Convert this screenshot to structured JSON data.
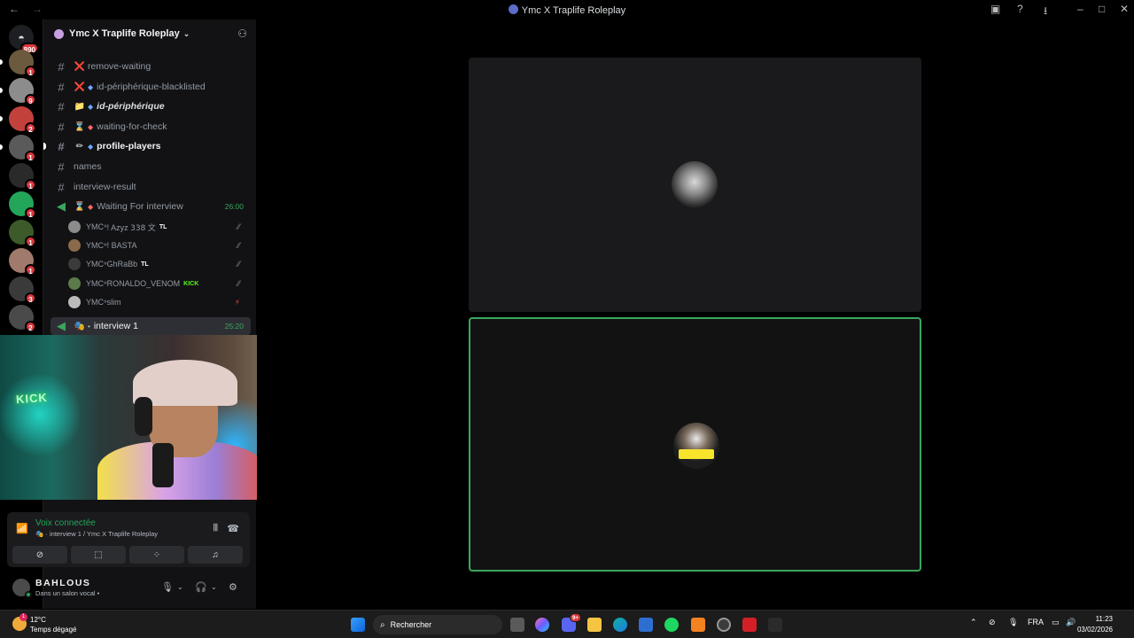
{
  "window": {
    "title": "Ymc X Traplife Roleplay"
  },
  "rail": {
    "home_badge": "890",
    "servers": [
      {
        "badge": "1",
        "color": "#6b5a3d"
      },
      {
        "badge": "9",
        "color": "#8c8c8c"
      },
      {
        "badge": "2",
        "color": "#c2413b"
      },
      {
        "badge": "1",
        "color": "#5a5a5a"
      },
      {
        "badge": "1",
        "color": "#2a2a2a"
      },
      {
        "badge": "1",
        "color": "#23a55a"
      },
      {
        "badge": "1",
        "color": "#3d5a2a"
      },
      {
        "badge": "1",
        "color": "#a07a6b"
      },
      {
        "badge": "3",
        "color": "#3a3a3a"
      },
      {
        "badge": "2",
        "color": "#4a4a4a"
      }
    ]
  },
  "server": {
    "name": "Ymc X Traplife Roleplay",
    "chevron": "⌄"
  },
  "channels": [
    {
      "emoji": "❌",
      "name": "remove-waiting",
      "diamond": ""
    },
    {
      "emoji": "❌",
      "name": "id-périphérique-blacklisted",
      "diamond": "◆"
    },
    {
      "emoji": "📁",
      "name": "id-périphérique",
      "diamond": "◆"
    },
    {
      "emoji": "⌛",
      "name": "waiting-for-check",
      "diamond": "◆"
    },
    {
      "emoji": "✏",
      "name": "profile-players",
      "diamond": "◆"
    },
    {
      "emoji": "",
      "name": "names",
      "diamond": ""
    },
    {
      "emoji": "",
      "name": "interview-result",
      "diamond": ""
    }
  ],
  "voice_channels": {
    "waiting": {
      "name": "Waiting For interview",
      "timer": "26:00"
    },
    "interview": {
      "name": "interview 1",
      "timer": "25:20"
    }
  },
  "voice_users": [
    {
      "prefix": "YMC",
      "name": "! Azyz 𝟥𝟥𝟪 文",
      "tag": "TL",
      "color": "#8b8b8b"
    },
    {
      "prefix": "YMC",
      "name": "! BASTA",
      "tag": "",
      "color": "#8a6a4a"
    },
    {
      "prefix": "YMC",
      "name": "GhRaBb",
      "tag": "TL",
      "color": "#3b3b3b"
    },
    {
      "prefix": "YMC",
      "name": "RONALDO_VENOM",
      "tag": "KICK",
      "color": "#5c7a4a"
    },
    {
      "prefix": "YMC",
      "name": "slim",
      "tag": "",
      "color": "#bbbbbb"
    }
  ],
  "voice_panel": {
    "status": "Voix connectée",
    "location": "interview 1 / Ymc X Traplife Roleplay"
  },
  "user": {
    "name": "BAHLOUS",
    "status": "Dans un salon vocal •"
  },
  "webcam": {
    "sign_text": "KICK"
  },
  "taskbar": {
    "temperature": "12°C",
    "weather": "Temps dégagé",
    "search_placeholder": "Rechercher",
    "language": "FRA",
    "time": "11:23",
    "date": "03/02/2026",
    "discord_badge": "9+",
    "weather_badge": "1"
  },
  "colors": {
    "accent_green": "#23a55a",
    "speaking_border": "#3ba55d",
    "badge_red": "#da373c"
  }
}
